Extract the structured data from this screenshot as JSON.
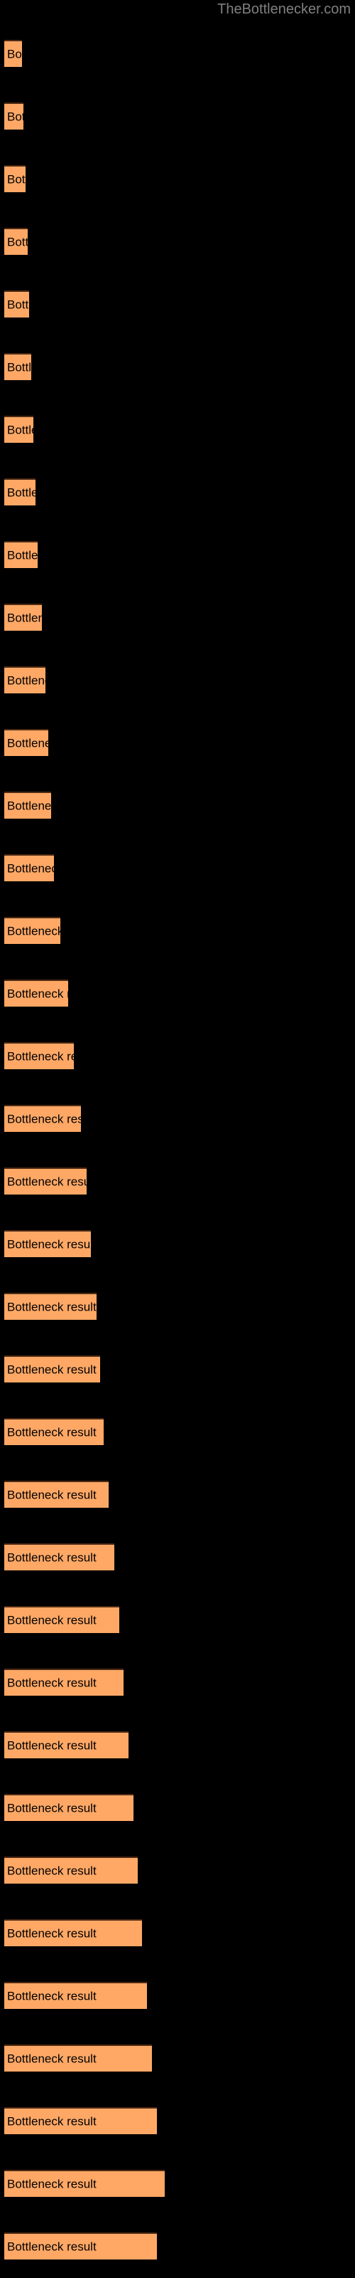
{
  "watermark": {
    "text": "TheBottlenecker.com",
    "color": "#808080"
  },
  "chart_data": {
    "type": "bar",
    "orientation": "horizontal",
    "title": "",
    "subtitle": "",
    "xlabel": "",
    "ylabel": "",
    "grid": false,
    "legend": false,
    "background_color": "#000000",
    "bar_color": "#ffa866",
    "bar_edge_color": "#4d2a14",
    "label_color": "#000000",
    "bar_label_text": "Bottleneck result",
    "xlim": [
      0,
      240
    ],
    "categories": [
      "Bottleneck result",
      "Bottleneck result",
      "Bottleneck result",
      "Bottleneck result",
      "Bottleneck result",
      "Bottleneck result",
      "Bottleneck result",
      "Bottleneck result",
      "Bottleneck result",
      "Bottleneck result",
      "Bottleneck result",
      "Bottleneck result",
      "Bottleneck result",
      "Bottleneck result",
      "Bottleneck result",
      "Bottleneck result",
      "Bottleneck result",
      "Bottleneck result",
      "Bottleneck result",
      "Bottleneck result",
      "Bottleneck result",
      "Bottleneck result",
      "Bottleneck result",
      "Bottleneck result",
      "Bottleneck result",
      "Bottleneck result",
      "Bottleneck result",
      "Bottleneck result",
      "Bottleneck result",
      "Bottleneck result",
      "Bottleneck result",
      "Bottleneck result",
      "Bottleneck result",
      "Bottleneck result",
      "Bottleneck result",
      "Bottleneck result"
    ],
    "values": [
      25,
      27,
      30,
      33,
      35,
      38,
      41,
      44,
      47,
      53,
      58,
      62,
      66,
      70,
      79,
      90,
      98,
      108,
      116,
      122,
      130,
      135,
      140,
      147,
      155,
      162,
      168,
      175,
      182,
      188,
      194,
      201,
      208,
      215,
      226,
      215
    ],
    "bar_tops": [
      56,
      144,
      232,
      320,
      408,
      496,
      584,
      672,
      760,
      848,
      936,
      1024,
      1112,
      1200,
      1288,
      1376,
      1464,
      1552,
      1640,
      1728,
      1816,
      1904,
      1992,
      2080,
      2168,
      2256,
      2344,
      2432,
      2520,
      2608,
      2696,
      2784,
      2872,
      2960,
      3048,
      3136
    ]
  }
}
